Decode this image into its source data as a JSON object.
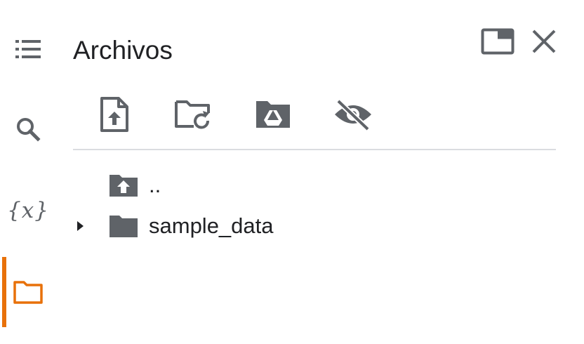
{
  "panel": {
    "title": "Archivos"
  },
  "rail": {
    "items": [
      {
        "name": "table-of-contents",
        "icon": "list-icon"
      },
      {
        "name": "search",
        "icon": "search-icon"
      },
      {
        "name": "variables",
        "icon": "variables-icon",
        "glyph": "{x}"
      },
      {
        "name": "files",
        "icon": "folder-icon",
        "active": true
      }
    ],
    "active_color": "#e8710a"
  },
  "header_actions": [
    {
      "name": "open-in-tab",
      "icon": "window-icon"
    },
    {
      "name": "close",
      "icon": "close-icon"
    }
  ],
  "toolbar": [
    {
      "name": "upload-file",
      "icon": "upload-file-icon"
    },
    {
      "name": "refresh",
      "icon": "folder-refresh-icon"
    },
    {
      "name": "mount-drive",
      "icon": "drive-folder-icon"
    },
    {
      "name": "toggle-hidden-files",
      "icon": "eye-off-icon"
    }
  ],
  "tree": {
    "items": [
      {
        "label": "..",
        "icon": "folder-up-icon",
        "expandable": false
      },
      {
        "label": "sample_data",
        "icon": "folder-icon",
        "expandable": true
      }
    ]
  },
  "colors": {
    "icon": "#5f6368",
    "text": "#202124",
    "divider": "#dadce0"
  }
}
